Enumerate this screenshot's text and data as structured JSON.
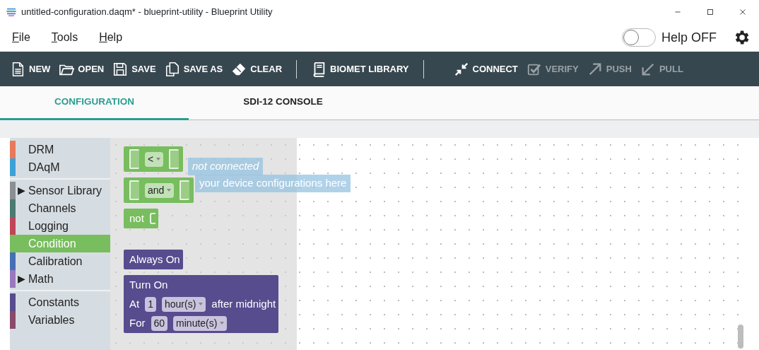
{
  "window": {
    "title": "untitled-configuration.daqm* - blueprint-utility - Blueprint Utility"
  },
  "menu": [
    {
      "label": "File"
    },
    {
      "label": "Tools"
    },
    {
      "label": "Help"
    }
  ],
  "help_toggle": {
    "label": "Help OFF",
    "on": false
  },
  "toolbar": [
    {
      "kind": "button",
      "label": "NEW",
      "disabled": false
    },
    {
      "kind": "button",
      "label": "OPEN",
      "disabled": false
    },
    {
      "kind": "button",
      "label": "SAVE",
      "disabled": false
    },
    {
      "kind": "button",
      "label": "SAVE AS",
      "disabled": false
    },
    {
      "kind": "button",
      "label": "CLEAR",
      "disabled": false
    },
    {
      "kind": "separator"
    },
    {
      "kind": "button",
      "label": "BIOMET LIBRARY",
      "disabled": false
    },
    {
      "kind": "separator"
    },
    {
      "kind": "button",
      "label": "CONNECT",
      "disabled": false
    },
    {
      "kind": "button",
      "label": "VERIFY",
      "disabled": true
    },
    {
      "kind": "button",
      "label": "PUSH",
      "disabled": true
    },
    {
      "kind": "button",
      "label": "PULL",
      "disabled": true
    }
  ],
  "tabs": [
    {
      "label": "CONFIGURATION",
      "selected": true
    },
    {
      "label": "SDI-12 CONSOLE",
      "selected": false
    }
  ],
  "toolbox": {
    "groups": [
      [
        {
          "label": "DRM",
          "color": "#e8795a",
          "selected": false
        },
        {
          "label": "DAqM",
          "color": "#3ea0d8",
          "selected": false
        }
      ],
      [
        {
          "label": "Sensor Library",
          "color": "#8a8f93",
          "selected": false,
          "arrow": "▶"
        },
        {
          "label": "Channels",
          "color": "#4a7a72",
          "selected": false
        },
        {
          "label": "Logging",
          "color": "#c0445a",
          "selected": false
        },
        {
          "label": "Condition",
          "color": "#78bd5e",
          "selected": true
        },
        {
          "label": "Calibration",
          "color": "#4570b5",
          "selected": false
        },
        {
          "label": "Math",
          "color": "#9a78c0",
          "selected": false,
          "arrow": "▶"
        }
      ],
      [
        {
          "label": "Constants",
          "color": "#574c8e",
          "selected": false
        },
        {
          "label": "Variables",
          "color": "#8a4a6a",
          "selected": false
        }
      ]
    ]
  },
  "workspace": {
    "notices": [
      {
        "text": "not connected"
      },
      {
        "text": "your device configurations here"
      }
    ]
  },
  "flyout": {
    "blocks": [
      {
        "kind": "compare",
        "color": "#78bd5e",
        "rows": [
          [
            {
              "kind": "socket"
            },
            {
              "kind": "dropdown",
              "text": "<"
            },
            {
              "kind": "socket"
            }
          ]
        ]
      },
      {
        "kind": "compare",
        "color": "#78bd5e",
        "rows": [
          [
            {
              "kind": "socket"
            },
            {
              "kind": "dropdown",
              "text": "and"
            },
            {
              "kind": "socket"
            }
          ]
        ]
      },
      {
        "kind": "value",
        "color": "#78bd5e",
        "rows": [
          [
            {
              "kind": "text",
              "text": "not"
            },
            {
              "kind": "input"
            }
          ]
        ]
      },
      {
        "kind": "statement",
        "color": "#574c8e",
        "rows": [
          [
            {
              "kind": "text",
              "text": "Always On"
            }
          ]
        ]
      },
      {
        "kind": "statement",
        "color": "#574c8e",
        "rows": [
          [
            {
              "kind": "text",
              "text": "Turn On"
            }
          ],
          [
            {
              "kind": "text",
              "text": "At"
            },
            {
              "kind": "number",
              "text": "1"
            },
            {
              "kind": "dropdown",
              "text": "hour(s)"
            },
            {
              "kind": "text",
              "text": "after midnight"
            }
          ],
          [
            {
              "kind": "text",
              "text": "For"
            },
            {
              "kind": "number",
              "text": "60"
            },
            {
              "kind": "dropdown",
              "text": "minute(s)"
            }
          ]
        ]
      }
    ]
  }
}
